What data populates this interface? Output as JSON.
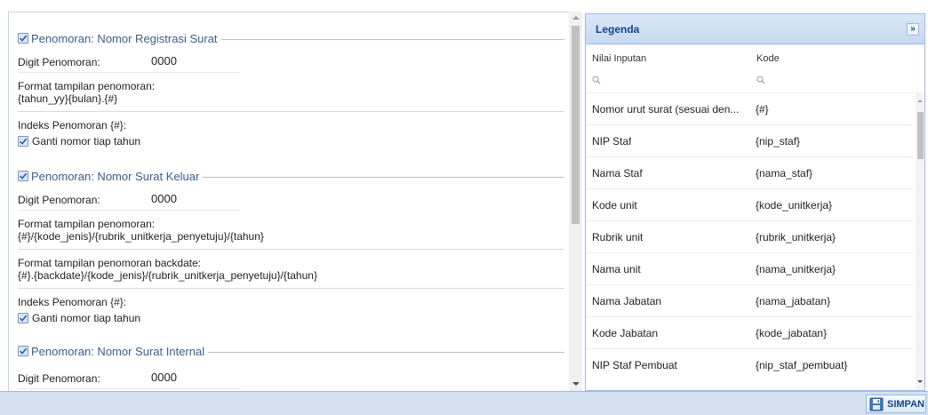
{
  "sections": [
    {
      "legend": "Penomoran: Nomor Registrasi Surat",
      "digit_label": "Digit Penomoran:",
      "digit_value": "0000",
      "format_label": "Format tampilan penomoran:",
      "format_value": "{tahun_yy}{bulan}.{#}",
      "index_label": "Indeks Penomoran {#}:",
      "checkbox_label": "Ganti nomor tiap tahun"
    },
    {
      "legend": "Penomoran: Nomor Surat Keluar",
      "digit_label": "Digit Penomoran:",
      "digit_value": "0000",
      "format_label": "Format tampilan penomoran:",
      "format_value": "{#}/{kode_jenis}/{rubrik_unitkerja_penyetuju}/{tahun}",
      "backdate_label": "Format tampilan penomoran backdate:",
      "backdate_value": "{#}.{backdate}/{kode_jenis}/{rubrik_unitkerja_penyetuju}/{tahun}",
      "index_label": "Indeks Penomoran {#}:",
      "checkbox_label": "Ganti nomor tiap tahun"
    },
    {
      "legend": "Penomoran: Nomor Surat Internal",
      "digit_label": "Digit Penomoran:",
      "digit_value": "0000"
    }
  ],
  "legenda": {
    "title": "Legenda",
    "collapse_glyph": "»",
    "col_input": "Nilai Inputan",
    "col_code": "Kode",
    "rows": [
      {
        "input": "Nomor urut surat (sesuai den...",
        "code": "{#}"
      },
      {
        "input": "NIP Staf",
        "code": "{nip_staf}"
      },
      {
        "input": "Nama Staf",
        "code": "{nama_staf}"
      },
      {
        "input": "Kode unit",
        "code": "{kode_unitkerja}"
      },
      {
        "input": "Rubrik unit",
        "code": "{rubrik_unitkerja}"
      },
      {
        "input": "Nama unit",
        "code": "{nama_unitkerja}"
      },
      {
        "input": "Nama Jabatan",
        "code": "{nama_jabatan}"
      },
      {
        "input": "Kode Jabatan",
        "code": "{kode_jabatan}"
      },
      {
        "input": "NIP Staf Pembuat",
        "code": "{nip_staf_pembuat}"
      }
    ]
  },
  "footer": {
    "save_label": "SIMPAN"
  },
  "colors": {
    "accent": "#15428b",
    "legend_text": "#3d5d8a",
    "footer_bg": "#d3e1f1",
    "panel_border": "#99bbe8"
  },
  "icons": {
    "checkbox": "checkbox-checked-icon",
    "search": "search-icon",
    "save": "floppy-disk-icon",
    "collapse": "double-chevron-right-icon"
  }
}
